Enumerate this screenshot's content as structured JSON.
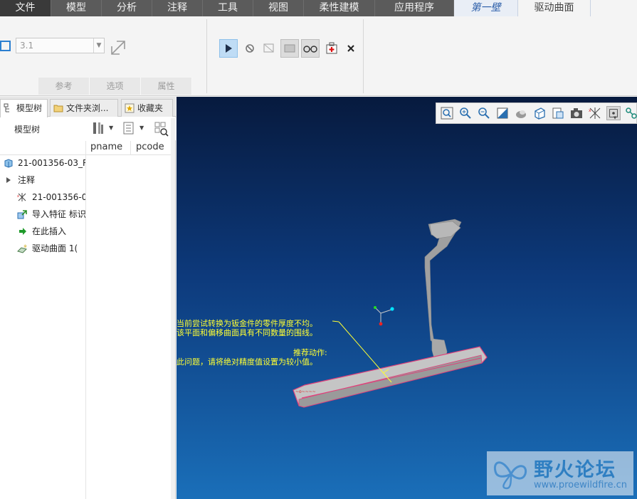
{
  "ribbon_tabs": [
    {
      "label": "文件"
    },
    {
      "label": "模型"
    },
    {
      "label": "分析"
    },
    {
      "label": "注释"
    },
    {
      "label": "工具"
    },
    {
      "label": "视图"
    },
    {
      "label": "柔性建模"
    },
    {
      "label": "应用程序"
    },
    {
      "label": "第一壁"
    },
    {
      "label": "驱动曲面"
    }
  ],
  "ribbon": {
    "thickness_value": "3.1",
    "groups": [
      "参考",
      "选项",
      "属性"
    ]
  },
  "left_panel": {
    "tabs": [
      "模型树",
      "文件夹浏...",
      "收藏夹"
    ],
    "tree_title": "模型树",
    "columns": [
      "pname",
      "pcode"
    ],
    "items": [
      {
        "label": "21-001356-03_R",
        "icon": "part-icon"
      },
      {
        "label": "注释",
        "icon": "expand-arrow-icon"
      },
      {
        "label": "21-001356-0",
        "icon": "csys-icon"
      },
      {
        "label": "导入特征 标识",
        "icon": "import-feature-icon"
      },
      {
        "label": "在此插入",
        "icon": "insert-here-arrow-icon"
      },
      {
        "label": "驱动曲面 1(",
        "icon": "driving-surface-icon"
      }
    ]
  },
  "viewport": {
    "message_lines": [
      "当前尝试转换为钣金件的零件厚度不均。",
      "该平面和偏移曲面具有不同数量的围线。",
      "推荐动作:",
      "此问题，请将绝对精度值设置为较小值。"
    ]
  },
  "watermark": {
    "title": "野火论坛",
    "url": "www.proewildfire.cn"
  }
}
